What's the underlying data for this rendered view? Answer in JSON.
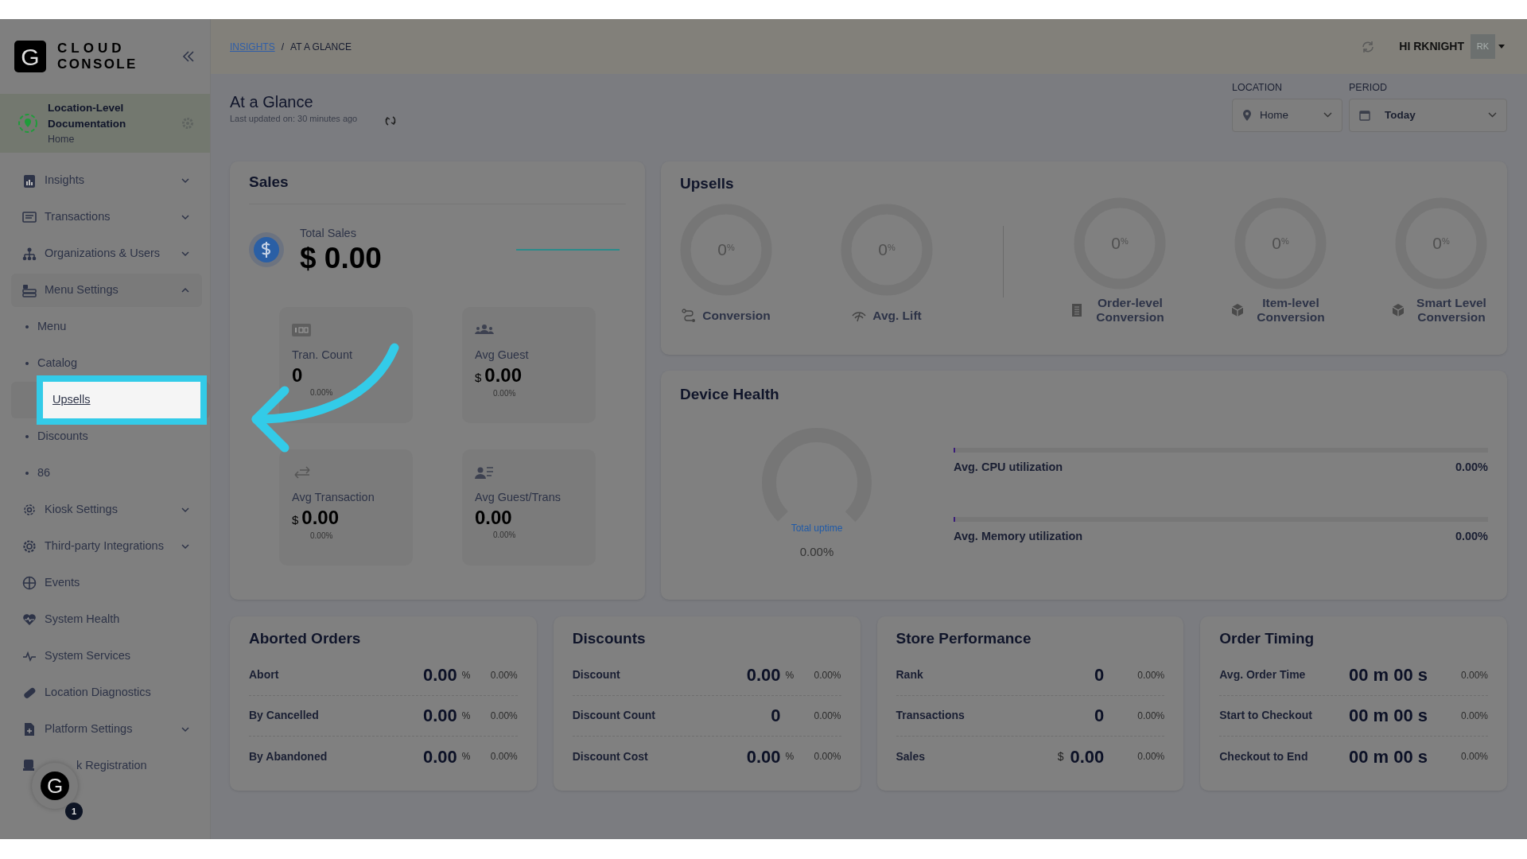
{
  "brand": {
    "logo": "G",
    "line1": "CLOUD",
    "line2": "CONSOLE"
  },
  "location": {
    "name": "Location-Level Documentation",
    "sub": "Home"
  },
  "sidebar": {
    "items": [
      {
        "label": "Insights",
        "kind": "group",
        "expanded": false
      },
      {
        "label": "Transactions",
        "kind": "group",
        "expanded": false
      },
      {
        "label": "Organizations & Users",
        "kind": "group",
        "expanded": false
      },
      {
        "label": "Menu Settings",
        "kind": "group",
        "expanded": true,
        "children": [
          {
            "label": "Menu",
            "selected": false
          },
          {
            "label": "Catalog",
            "selected": false
          },
          {
            "label": "Upsells",
            "selected": true
          },
          {
            "label": "Discounts",
            "selected": false
          },
          {
            "label": "86",
            "selected": false
          }
        ]
      },
      {
        "label": "Kiosk Settings",
        "kind": "group",
        "expanded": false
      },
      {
        "label": "Third-party Integrations",
        "kind": "group",
        "expanded": false
      },
      {
        "label": "Events",
        "kind": "link"
      },
      {
        "label": "System Health",
        "kind": "link"
      },
      {
        "label": "System Services",
        "kind": "link"
      },
      {
        "label": "Location Diagnostics",
        "kind": "link"
      },
      {
        "label": "Platform Settings",
        "kind": "group",
        "expanded": false
      },
      {
        "label": "k Registration",
        "kind": "link"
      }
    ]
  },
  "chat": {
    "logo": "G",
    "badge": "1"
  },
  "header": {
    "breadcrumb": [
      "INSIGHTS",
      "AT A GLANCE"
    ],
    "separator": "/",
    "greeting": "HI RKNIGHT",
    "avatar": "RK"
  },
  "page": {
    "title": "At a Glance",
    "updated": "Last updated on: 30 minutes ago"
  },
  "filters": [
    {
      "label": "LOCATION",
      "value": "Home"
    },
    {
      "label": "PERIOD",
      "value": "Today"
    }
  ],
  "sales": {
    "title": "Sales",
    "total_label": "Total Sales",
    "total": "$ 0.00",
    "tiles": [
      {
        "label": "Tran. Count",
        "value": "0",
        "change": "0.00%"
      },
      {
        "label": "Avg Guest",
        "currency": "$",
        "value": "0.00",
        "change": "0.00%"
      },
      {
        "label": "Avg Transaction",
        "currency": "$",
        "value": "0.00",
        "change": "0.00%"
      },
      {
        "label": "Avg Guest/Trans",
        "value": "0.00",
        "change": "0.00%"
      }
    ]
  },
  "upsells": {
    "title": "Upsells",
    "groups": [
      [
        {
          "value": "0$^{%}$",
          "label": "Conversion"
        },
        {
          "value": "0$^{%}$",
          "label": "Avg. Lift"
        }
      ],
      [
        {
          "value": "0$^{%}$",
          "label": "Order-level Conversion"
        },
        {
          "value": "0$^{%}$",
          "label": "Item-level Conversion"
        },
        {
          "value": "0$^{%}$",
          "label": "Smart Level Conversion"
        }
      ]
    ]
  },
  "device_health": {
    "title": "Device Health",
    "uptime_label": "Total uptime",
    "uptime": "0.00%",
    "bars": [
      {
        "label": "Avg. CPU utilization",
        "value": "0.00%",
        "level": 0
      },
      {
        "label": "Avg. Memory utilization",
        "value": "0.00%",
        "level": 0
      }
    ]
  },
  "cards": [
    {
      "title": "Aborted Orders",
      "rows": [
        {
          "label": "Abort",
          "value": "0.00",
          "unit": "%",
          "change": "0.00%"
        },
        {
          "label": "By Cancelled",
          "value": "0.00",
          "unit": "%",
          "change": "0.00%"
        },
        {
          "label": "By Abandoned",
          "value": "0.00",
          "unit": "%",
          "change": "0.00%"
        }
      ]
    },
    {
      "title": "Discounts",
      "rows": [
        {
          "label": "Discount",
          "value": "0.00",
          "unit": "%",
          "change": "0.00%"
        },
        {
          "label": "Discount Count",
          "value": "0",
          "change": "0.00%"
        },
        {
          "label": "Discount Cost",
          "value": "0.00",
          "unit": "%",
          "change": "0.00%"
        }
      ]
    },
    {
      "title": "Store Performance",
      "rows": [
        {
          "label": "Rank",
          "value": "0",
          "change": "0.00%"
        },
        {
          "label": "Transactions",
          "value": "0",
          "change": "0.00%"
        },
        {
          "label": "Sales",
          "prefix": "$",
          "value": "0.00",
          "change": "0.00%"
        }
      ]
    },
    {
      "title": "Order Timing",
      "rows": [
        {
          "label": "Avg. Order Time",
          "value": "00 m 00 s",
          "change": "0.00%"
        },
        {
          "label": "Start to Checkout",
          "value": "00 m 00 s",
          "change": "0.00%"
        },
        {
          "label": "Checkout to End",
          "value": "00 m 00 s",
          "change": "0.00%"
        }
      ]
    }
  ]
}
